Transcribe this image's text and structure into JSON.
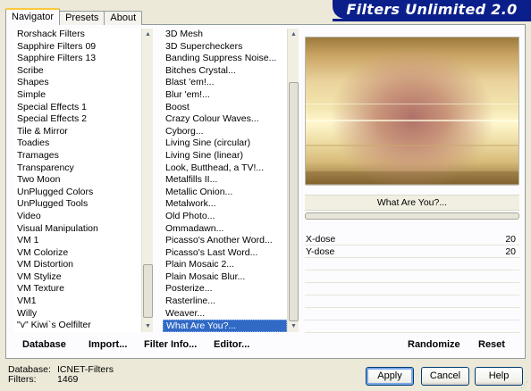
{
  "title": "Filters Unlimited 2.0",
  "tabs": [
    {
      "label": "Navigator",
      "active": true
    },
    {
      "label": "Presets",
      "active": false
    },
    {
      "label": "About",
      "active": false
    }
  ],
  "categories": [
    "Rorshack Filters",
    "Sapphire Filters 09",
    "Sapphire Filters 13",
    "Scribe",
    "Shapes",
    "Simple",
    "Special Effects 1",
    "Special Effects 2",
    "Tile & Mirror",
    "Toadies",
    "Tramages",
    "Transparency",
    "Two Moon",
    "UnPlugged Colors",
    "UnPlugged Tools",
    "Video",
    "Visual Manipulation",
    "VM 1",
    "VM Colorize",
    "VM Distortion",
    "VM Stylize",
    "VM Texture",
    "VM1",
    "Willy",
    "\"v\" Kiwi`s Oelfilter"
  ],
  "filters": [
    "3D Mesh",
    "3D Supercheckers",
    "Banding Suppress Noise...",
    "Bitches Crystal...",
    "Blast 'em!...",
    "Blur 'em!...",
    "Boost",
    "Crazy Colour Waves...",
    "Cyborg...",
    "Living Sine (circular)",
    "Living Sine (linear)",
    "Look, Butthead, a TV!...",
    "Metalfills II...",
    "Metallic Onion...",
    "Metalwork...",
    "Old Photo...",
    "Ommadawn...",
    "Picasso's Another Word...",
    "Picasso's Last Word...",
    "Plain Mosaic 2...",
    "Plain Mosaic Blur...",
    "Posterize...",
    "Rasterline...",
    "Weaver...",
    "What Are You?..."
  ],
  "selected_filter_index": 24,
  "selected_category": "Toadies",
  "preview_button": "What Are You?...",
  "parameters": [
    {
      "name": "X-dose",
      "value": "20"
    },
    {
      "name": "Y-dose",
      "value": "20"
    }
  ],
  "bottom_links": {
    "database": "Database",
    "import": "Import...",
    "filter_info": "Filter Info...",
    "editor": "Editor...",
    "randomize": "Randomize",
    "reset": "Reset"
  },
  "status": {
    "database_label": "Database:",
    "database_value": "ICNET-Filters",
    "filters_label": "Filters:",
    "filters_value": "1469"
  },
  "buttons": {
    "apply": "Apply",
    "cancel": "Cancel",
    "help": "Help"
  }
}
